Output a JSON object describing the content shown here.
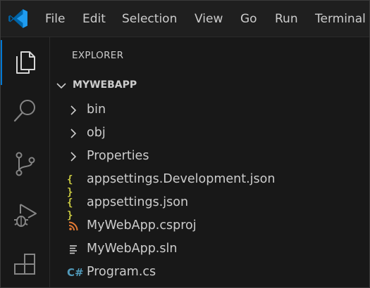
{
  "menubar": {
    "items": [
      "File",
      "Edit",
      "Selection",
      "View",
      "Go",
      "Run",
      "Terminal"
    ]
  },
  "activity_bar": {
    "items": [
      {
        "name": "explorer",
        "icon": "files-icon",
        "active": true
      },
      {
        "name": "search",
        "icon": "search-icon",
        "active": false
      },
      {
        "name": "source-control",
        "icon": "source-control-icon",
        "active": false
      },
      {
        "name": "run-and-debug",
        "icon": "run-debug-icon",
        "active": false
      },
      {
        "name": "extensions",
        "icon": "extensions-icon",
        "active": false
      }
    ]
  },
  "explorer": {
    "title": "EXPLORER",
    "folder": {
      "name": "MYWEBAPP",
      "expanded": true
    },
    "items": [
      {
        "label": "bin",
        "type": "folder",
        "icon": "chevron-right-icon"
      },
      {
        "label": "obj",
        "type": "folder",
        "icon": "chevron-right-icon"
      },
      {
        "label": "Properties",
        "type": "folder",
        "icon": "chevron-right-icon"
      },
      {
        "label": "appsettings.Development.json",
        "type": "json",
        "icon": "json-file-icon",
        "glyph": "{ }"
      },
      {
        "label": "appsettings.json",
        "type": "json",
        "icon": "json-file-icon",
        "glyph": "{ }"
      },
      {
        "label": "MyWebApp.csproj",
        "type": "csproj",
        "icon": "rss-file-icon"
      },
      {
        "label": "MyWebApp.sln",
        "type": "sln",
        "icon": "lines-file-icon"
      },
      {
        "label": "Program.cs",
        "type": "csharp",
        "icon": "csharp-file-icon",
        "glyph": "C#"
      }
    ]
  },
  "colors": {
    "accent": "#0078d4",
    "background": "#181818",
    "titlebar": "#1f1f1f",
    "text": "#cccccc",
    "json_icon": "#cbcb41",
    "csproj_icon": "#e37933",
    "csharp_icon": "#519aba"
  }
}
